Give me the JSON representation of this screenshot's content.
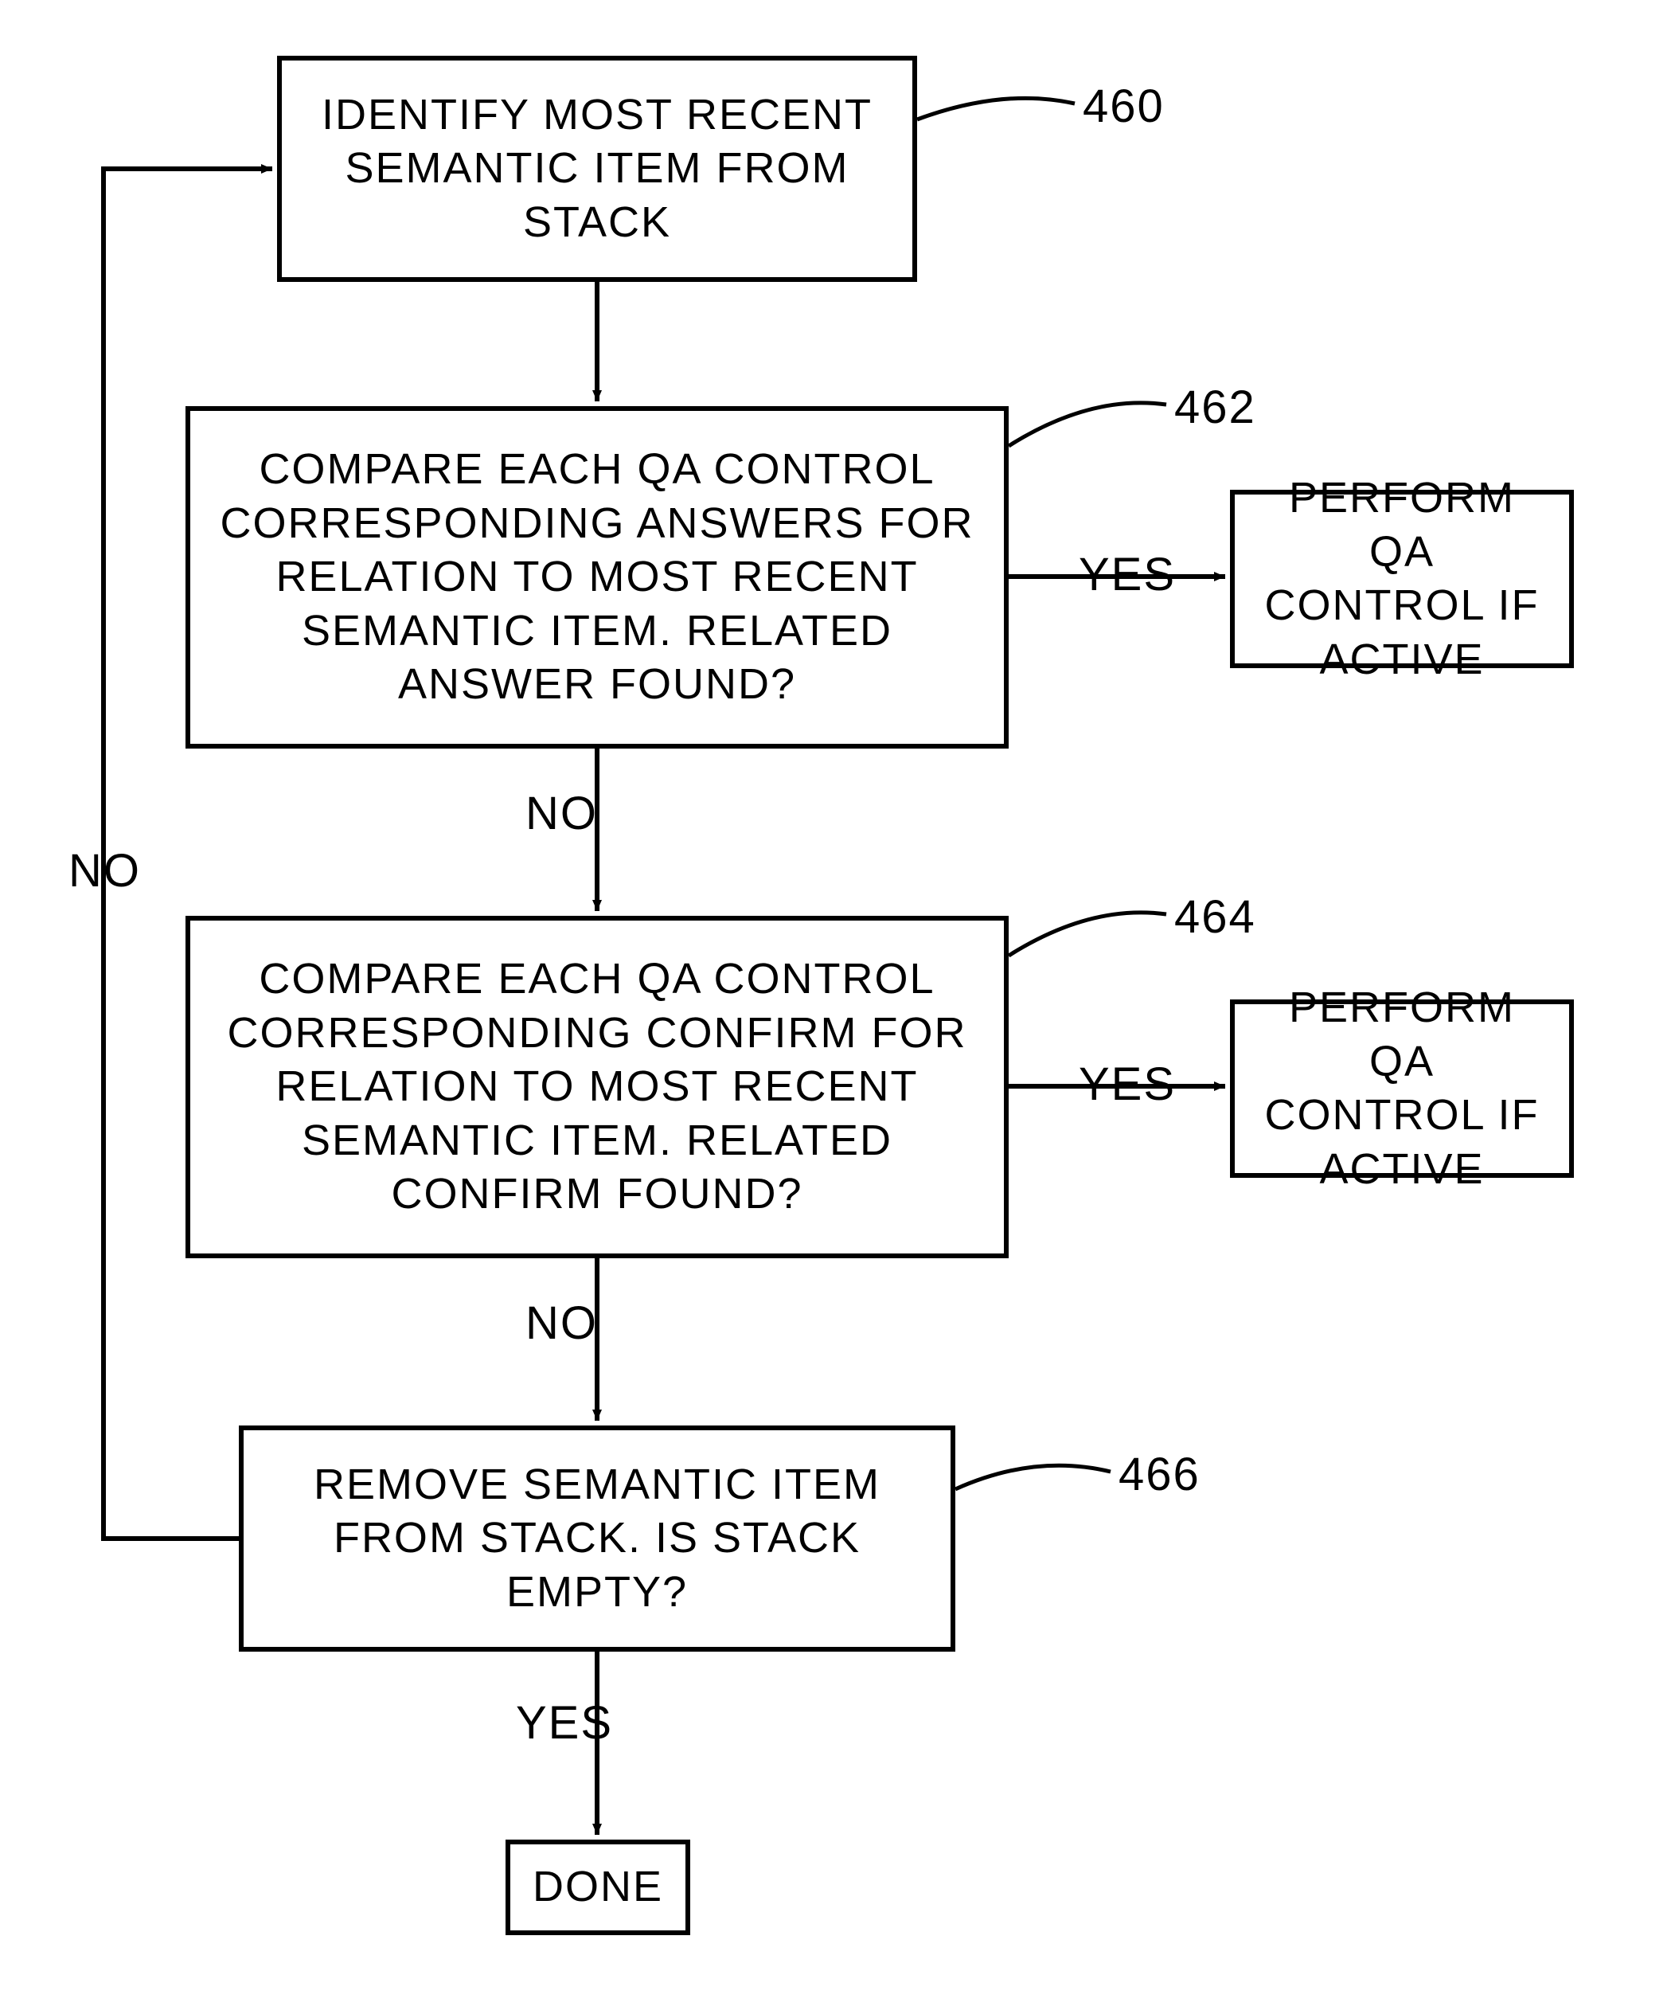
{
  "chart_data": {
    "type": "flowchart",
    "nodes": [
      {
        "id": "n460",
        "ref": "460",
        "text": "IDENTIFY MOST RECENT SEMANTIC ITEM FROM STACK"
      },
      {
        "id": "n462",
        "ref": "462",
        "text": "COMPARE EACH QA CONTROL CORRESPONDING ANSWERS FOR RELATION TO MOST RECENT SEMANTIC ITEM. RELATED ANSWER FOUND?"
      },
      {
        "id": "n464",
        "ref": "464",
        "text": "COMPARE EACH QA CONTROL CORRESPONDING CONFIRM FOR RELATION TO MOST RECENT SEMANTIC ITEM. RELATED CONFIRM FOUND?"
      },
      {
        "id": "n466",
        "ref": "466",
        "text": "REMOVE SEMANTIC ITEM FROM STACK. IS STACK EMPTY?"
      },
      {
        "id": "p462out",
        "text": "PERFORM QA CONTROL IF ACTIVE"
      },
      {
        "id": "p464out",
        "text": "PERFORM QA CONTROL IF ACTIVE"
      },
      {
        "id": "done",
        "text": "DONE"
      }
    ],
    "edges": [
      {
        "from": "n460",
        "to": "n462",
        "label": ""
      },
      {
        "from": "n462",
        "to": "p462out",
        "label": "YES"
      },
      {
        "from": "n462",
        "to": "n464",
        "label": "NO"
      },
      {
        "from": "n464",
        "to": "p464out",
        "label": "YES"
      },
      {
        "from": "n464",
        "to": "n466",
        "label": "NO"
      },
      {
        "from": "n466",
        "to": "done",
        "label": "YES"
      },
      {
        "from": "n466",
        "to": "n460",
        "label": "NO"
      }
    ],
    "edge_labels": {
      "yes": "YES",
      "no": "NO"
    }
  },
  "boxes": {
    "b460": "IDENTIFY MOST RECENT\nSEMANTIC ITEM FROM\nSTACK",
    "b462": "COMPARE EACH QA CONTROL\nCORRESPONDING ANSWERS FOR\nRELATION TO MOST RECENT\nSEMANTIC ITEM. RELATED\nANSWER FOUND?",
    "b464": "COMPARE EACH QA CONTROL\nCORRESPONDING CONFIRM FOR\nRELATION TO MOST RECENT\nSEMANTIC ITEM. RELATED\nCONFIRM FOUND?",
    "b466": "REMOVE SEMANTIC ITEM\nFROM STACK. IS STACK\nEMPTY?",
    "perform": "PERFORM QA\nCONTROL IF\nACTIVE",
    "done": "DONE"
  },
  "labels": {
    "yes": "YES",
    "no": "NO",
    "ref460": "460",
    "ref462": "462",
    "ref464": "464",
    "ref466": "466"
  }
}
